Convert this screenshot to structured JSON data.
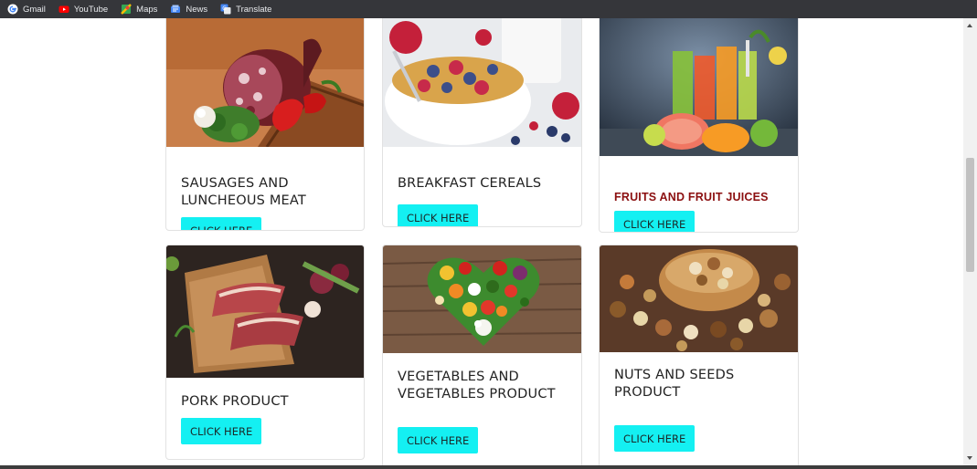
{
  "bookmarks": [
    {
      "label": "Gmail",
      "icon": "google-icon"
    },
    {
      "label": "YouTube",
      "icon": "youtube-icon"
    },
    {
      "label": "Maps",
      "icon": "maps-icon"
    },
    {
      "label": "News",
      "icon": "news-icon"
    },
    {
      "label": "Translate",
      "icon": "translate-icon"
    }
  ],
  "products": [
    {
      "title": "SAUSAGES AND LUNCHEOUS MEAT",
      "button": "CLICK HERE"
    },
    {
      "title": "BREAKFAST CEREALS",
      "button": "CLICK HERE"
    },
    {
      "title": "FRUITS AND FRUIT JUICES",
      "button": "CLICK HERE"
    },
    {
      "title": "PORK PRODUCT",
      "button": "CLICK HERE"
    },
    {
      "title": "VEGETABLES AND VEGETABLES PRODUCT",
      "button": "CLICK HERE"
    },
    {
      "title": "NUTS AND SEEDS PRODUCT",
      "button": "CLICK HERE"
    }
  ],
  "colors": {
    "button": "#14f0f2",
    "fruit_title": "#8b0f10",
    "bookmarks_bar": "#35363a"
  }
}
